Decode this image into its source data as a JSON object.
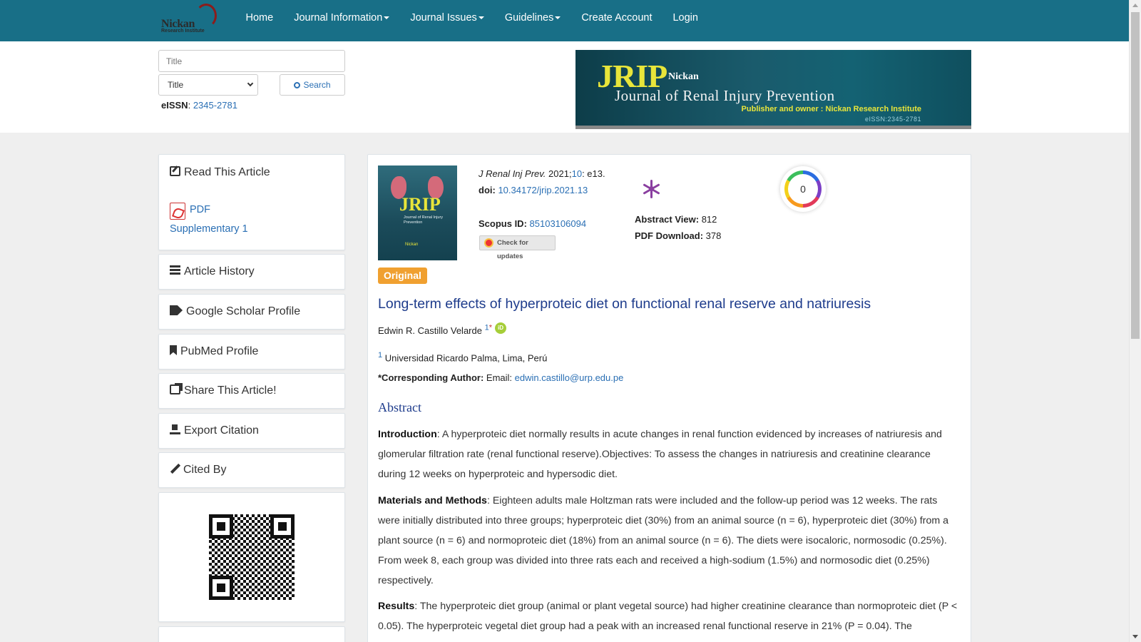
{
  "nav": {
    "logo_text": "Nickan",
    "logo_sub": "Research Institute",
    "items": [
      {
        "label": "Home",
        "dropdown": false
      },
      {
        "label": "Journal Information",
        "dropdown": true
      },
      {
        "label": "Journal Issues",
        "dropdown": true
      },
      {
        "label": "Guidelines",
        "dropdown": true
      },
      {
        "label": "Create Account",
        "dropdown": false
      },
      {
        "label": "Login",
        "dropdown": false
      }
    ],
    "bg_color": "#186f87"
  },
  "search": {
    "placeholder": "Title",
    "select_value": "Title",
    "button_label": "Search"
  },
  "issn": {
    "label": "eISSN",
    "value": "2345-2781"
  },
  "banner": {
    "acronym": "JRIP",
    "publisher_brand": "Nickan",
    "title": "Journal of Renal Injury Prevention",
    "publisher_line": "Publisher and owner : Nickan Research Institute",
    "eissn": "eISSN:2345-2781"
  },
  "sidebar": {
    "read_article": {
      "title": "Read This Article",
      "links": [
        "PDF",
        "Supplementary 1"
      ]
    },
    "sections": [
      {
        "title": "Article History",
        "icon": "list-icon"
      },
      {
        "title": "Google Scholar Profile",
        "icon": "tags-icon"
      },
      {
        "title": "PubMed Profile",
        "icon": "bookmark-icon"
      },
      {
        "title": "Share This Article!",
        "icon": "share-icon"
      },
      {
        "title": "Export Citation",
        "icon": "export-icon"
      },
      {
        "title": "Cited By",
        "icon": "pencil-icon"
      }
    ]
  },
  "article": {
    "cover": {
      "acronym": "JRIP",
      "subtitle": "Journal of Renal Injury Prevention",
      "publisher": "Nickan"
    },
    "journal_abbrev": "J Renal Inj Prev.",
    "year": "2021;",
    "volume": "10",
    "elocator": ": e13.",
    "doi_label": "doi:",
    "doi": "10.34172/jrip.2021.13",
    "scopus_label": "Scopus ID:",
    "scopus_id": "85103106094",
    "check_updates": "Check for updates",
    "abstract_view_label": "Abstract View:",
    "abstract_views": "812",
    "pdf_download_label": "PDF Download:",
    "pdf_downloads": "378",
    "dimensions_count": "0",
    "type_badge": "Original",
    "title": "Long-term effects of hyperproteic diet on functional renal reserve and natriuresis",
    "author_name": "Edwin R. Castillo Velarde",
    "author_affil_num": "1",
    "author_corr_mark": "*",
    "affiliation_num": "1",
    "affiliation": "Universidad Ricardo Palma, Lima, Perú",
    "corr_label": "*Corresponding Author:",
    "email_label": "Email:",
    "email": "edwin.castillo@urp.edu.pe",
    "abstract_heading": "Abstract",
    "intro_label": "Introduction",
    "intro_text": ": A hyperproteic diet normally results in acute changes in renal function evidenced by increases of natriuresis and glomerular filtration rate (renal functional reserve).Objectives: To assess the changes in natriuresis and creatinine clearance during 12 weeks on hyperproteic and hypersodic diet.",
    "methods_label": "Materials and Methods",
    "methods_text": ": Eighteen adults male Holtzman rats were included and the follow-up period was 12 weeks. The rats were initially distributed into three groups; hyperproteic diet (30%) from an animal source (n = 6), hyperproteic diet (30%) from a plant source (n = 6) and normoproteic diet (18%) from an animal source (n = 6). The diets were isocaloric, normosodic (0.25%). From week 8, each group was divided into three rats each and received a high-sodium (1.5%) and normosodic diet (0.25%) respectively.",
    "results_label": "Results",
    "results_text": ": The hyperproteic diet group (animal or plant vegetal source) had higher creatinine clearance than normoproteic diet (P < 0.05). The hyperproteic vegetal diet group had a peak with an increased renal functional reserve in 21% (P = 0.04). The"
  }
}
